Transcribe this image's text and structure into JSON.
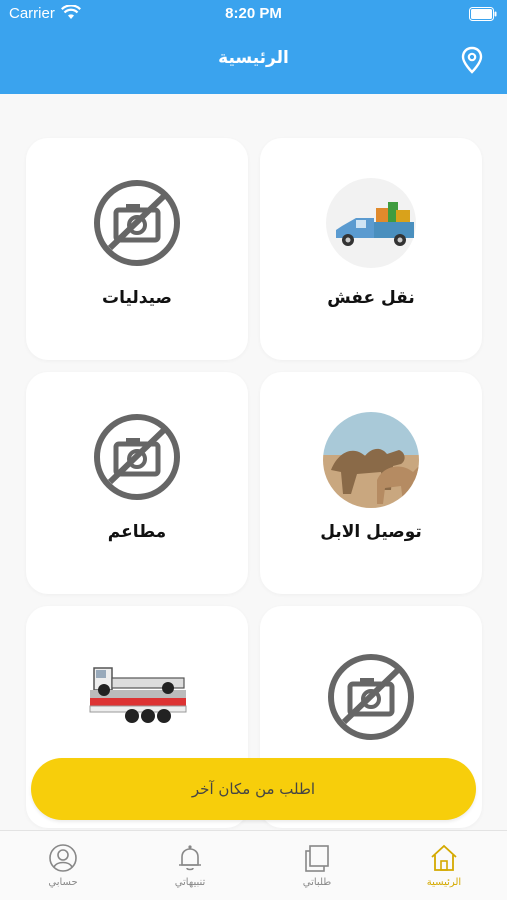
{
  "status_bar": {
    "carrier": "Carrier",
    "time": "8:20 PM"
  },
  "nav": {
    "title": "الرئيسية",
    "location_icon": "location-pin-icon"
  },
  "services": [
    {
      "label": "نقل عفش",
      "icon": "furniture-truck-image"
    },
    {
      "label": "صيدليات",
      "icon": "no-photo-icon"
    },
    {
      "label": "توصيل الابل",
      "icon": "camels-image"
    },
    {
      "label": "مطاعم",
      "icon": "no-photo-icon"
    },
    {
      "label": "",
      "icon": "no-photo-icon"
    },
    {
      "label": "",
      "icon": "tow-truck-image"
    }
  ],
  "cta": {
    "label": "اطلب من مكان آخر"
  },
  "tabs": [
    {
      "label": "حسابي",
      "icon": "profile-icon",
      "active": false
    },
    {
      "label": "تنبيهاتي",
      "icon": "bell-icon",
      "active": false
    },
    {
      "label": "طلباتي",
      "icon": "orders-icon",
      "active": false
    },
    {
      "label": "الرئيسية",
      "icon": "home-icon",
      "active": true
    }
  ],
  "colors": {
    "header": "#3aa3ee",
    "accent": "#f7ce0b",
    "active_tab": "#d4a900"
  }
}
